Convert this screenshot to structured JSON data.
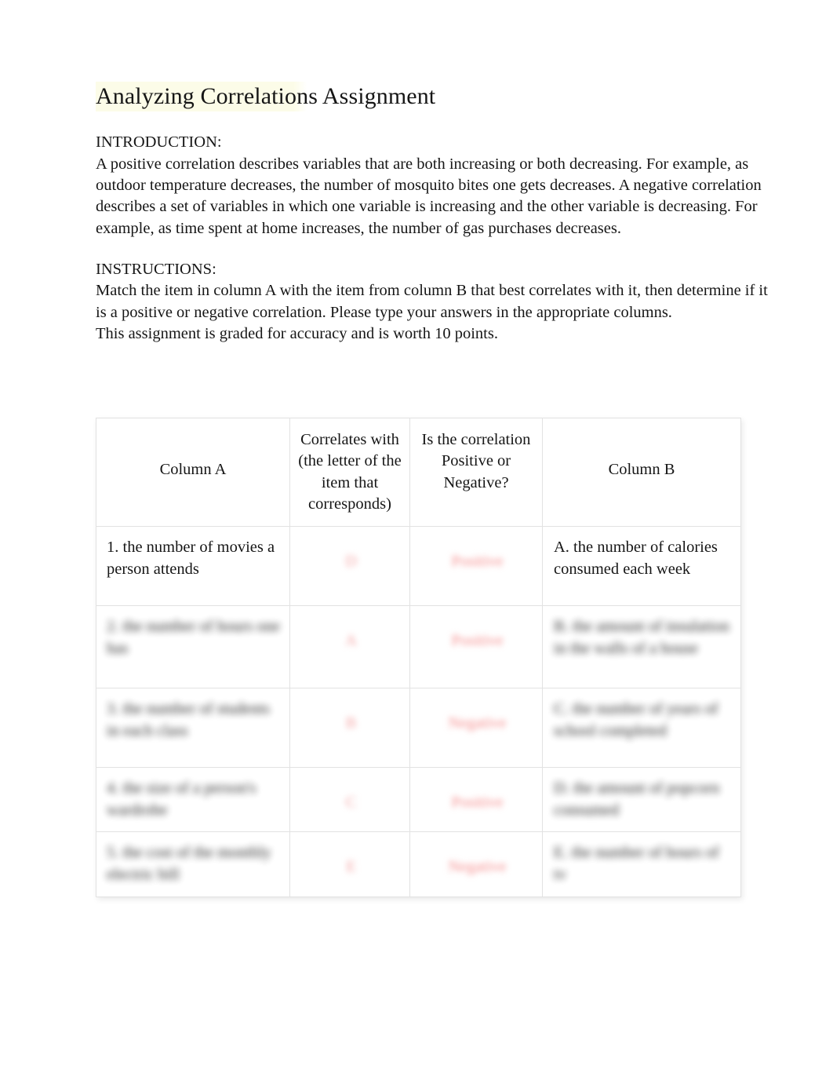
{
  "document": {
    "title": "Analyzing Correlations Assignment",
    "intro_label": "INTRODUCTION:",
    "intro_text": "A positive correlation describes variables that are both increasing or both decreasing. For example, as outdoor temperature decreases, the number of mosquito bites one gets decreases. A negative correlation describes a set of variables in which one variable is increasing and the other variable is decreasing. For example, as time spent at home increases, the number of gas purchases decreases.",
    "instructions_label": "INSTRUCTIONS:",
    "instructions_text": "Match the item in column A with the item from column B that best correlates with it, then determine if it is a positive or negative correlation. Please type your answers in the appropriate columns.",
    "grading_text": "This assignment is graded for accuracy and is worth 10 points."
  },
  "table": {
    "headers": {
      "column_a": "Column A",
      "correlates_with": "Correlates with (the letter of the item that corresponds)",
      "positive_or_negative": "Is the correlation Positive or Negative?",
      "column_b": "Column B"
    },
    "rows": [
      {
        "column_a": "1. the number of movies a person attends",
        "answer_letter": "D",
        "answer_sign": "Positive",
        "column_b": "A.  the number of calories consumed each week",
        "legible": true
      },
      {
        "column_a": "2. the number of hours one has",
        "answer_letter": "A",
        "answer_sign": "Positive",
        "column_b": "B.  the amount of insulation in the walls of a house",
        "legible": false
      },
      {
        "column_a": "3. the number of students in each class",
        "answer_letter": "B",
        "answer_sign": "Negative",
        "column_b": "C.  the number of years of school completed",
        "legible": false
      },
      {
        "column_a": "4. the size of a person's wardrobe",
        "answer_letter": "C",
        "answer_sign": "Positive",
        "column_b": "D.  the amount of popcorn consumed",
        "legible": false
      },
      {
        "column_a": "5. the cost of the monthly electric bill",
        "answer_letter": "E",
        "answer_sign": "Negative",
        "column_b": "E.  the number of hours of tv",
        "legible": false
      }
    ]
  },
  "colors": {
    "answer_text": "#f08a8a",
    "body_text": "#161616",
    "table_border": "#e2e2e2",
    "title_highlight": "#fcfce4"
  }
}
